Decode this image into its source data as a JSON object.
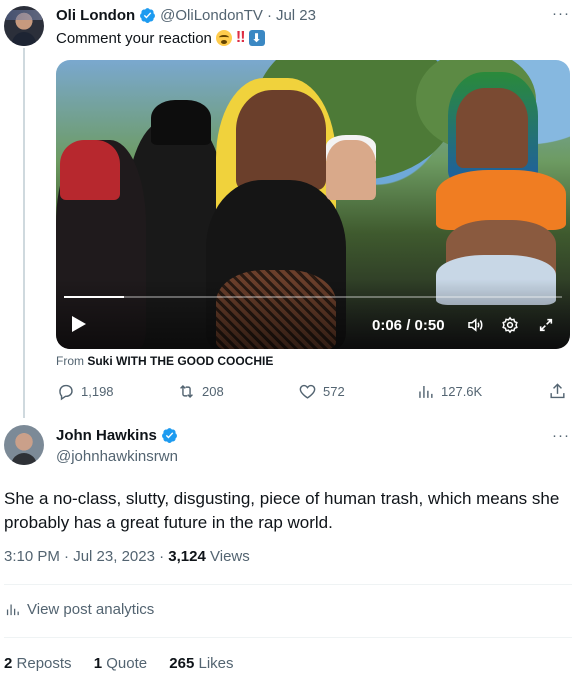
{
  "parent_tweet": {
    "name": "Oli London",
    "handle": "@OliLondonTV",
    "separator": "·",
    "date": "Jul 23",
    "text": "Comment your reaction",
    "more": "···",
    "video": {
      "current_time": "0:06",
      "duration": "0:50",
      "time_display": "0:06 / 0:50",
      "progress_fraction": 0.12
    },
    "from_prefix": "From",
    "from_source": "Suki WITH THE GOOD COOCHIE",
    "actions": {
      "replies": "1,198",
      "reposts": "208",
      "likes": "572",
      "views": "127.6K"
    }
  },
  "main_tweet": {
    "name": "John Hawkins",
    "handle": "@johnhawkinsrwn",
    "more": "···",
    "text": "She a no-class, slutty, disgusting, piece of human trash, which means she probably has a great future in the rap world.",
    "time": "3:10 PM",
    "date": "Jul 23, 2023",
    "dot": "·",
    "views_count": "3,124",
    "views_label": "Views",
    "analytics_label": "View post analytics",
    "reposts_count": "2",
    "reposts_label": "Reposts",
    "quotes_count": "1",
    "quotes_label": "Quote",
    "likes_count": "265",
    "likes_label": "Likes"
  },
  "colors": {
    "verified": "#1d9bf0",
    "secondary_text": "#536471",
    "primary_text": "#0f1419"
  }
}
